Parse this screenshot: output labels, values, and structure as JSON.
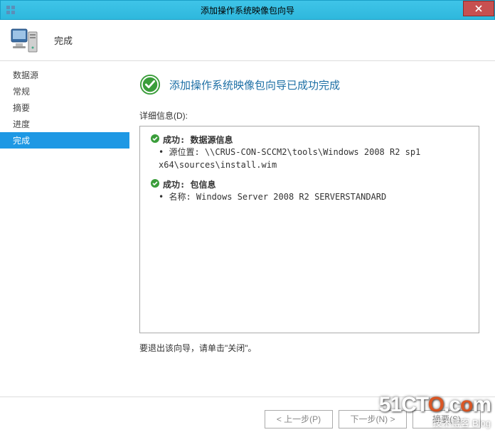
{
  "titlebar": {
    "title": "添加操作系统映像包向导"
  },
  "header": {
    "title": "完成"
  },
  "sidebar": {
    "items": [
      {
        "label": "数据源"
      },
      {
        "label": "常规"
      },
      {
        "label": "摘要"
      },
      {
        "label": "进度"
      },
      {
        "label": "完成",
        "active": true
      }
    ]
  },
  "main": {
    "completion_title": "添加操作系统映像包向导已成功完成",
    "details_label": "详细信息(D):",
    "results": [
      {
        "head": "成功: 数据源信息",
        "lines": [
          "源位置: \\\\CRUS-CON-SCCM2\\tools\\Windows 2008 R2 sp1 x64\\sources\\install.wim"
        ]
      },
      {
        "head": "成功: 包信息",
        "lines": [
          "名称: Windows Server 2008 R2 SERVERSTANDARD"
        ]
      }
    ],
    "exit_text": "要退出该向导，请单击\"关闭\"。"
  },
  "footer": {
    "prev": "< 上一步(P)",
    "next": "下一步(N) >",
    "summary": "摘要(S)"
  },
  "watermark": {
    "main_a": "51CT",
    "main_b": "O",
    "main_c": ".c",
    "main_d": "o",
    "main_e": "m",
    "sub": "技术博客    Blog"
  }
}
